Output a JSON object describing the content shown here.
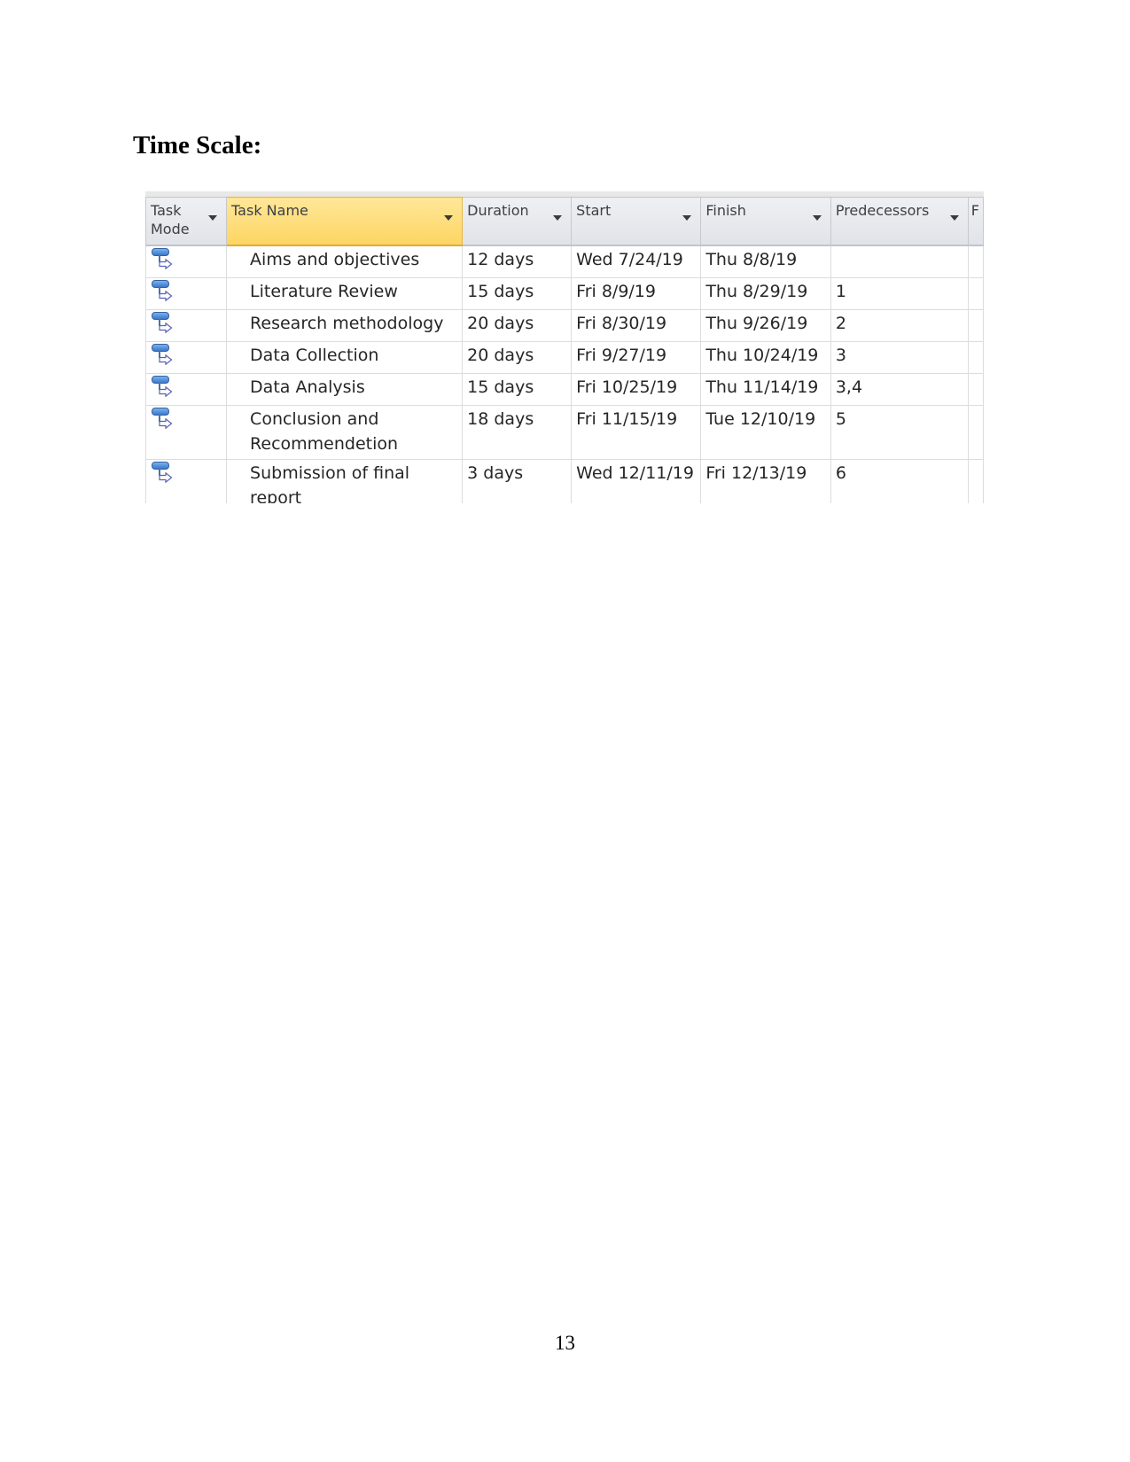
{
  "document": {
    "heading": "Time Scale:",
    "page_number": "13"
  },
  "table": {
    "columns": [
      {
        "key": "task_mode",
        "label": "Task Mode",
        "has_dropdown": true
      },
      {
        "key": "task_name",
        "label": "Task Name",
        "has_dropdown": true,
        "selected": true
      },
      {
        "key": "duration",
        "label": "Duration",
        "has_dropdown": true
      },
      {
        "key": "start",
        "label": "Start",
        "has_dropdown": true
      },
      {
        "key": "finish",
        "label": "Finish",
        "has_dropdown": true
      },
      {
        "key": "predecessors",
        "label": "Predecessors",
        "has_dropdown": true
      },
      {
        "key": "truncated",
        "label": "F",
        "has_dropdown": false
      }
    ],
    "task_mode_icon": "auto-scheduled-task-icon",
    "accent_color": "#fdd560",
    "rows": [
      {
        "task_name": "Aims and objectives",
        "duration": "12 days",
        "start": "Wed 7/24/19",
        "finish": "Thu 8/8/19",
        "predecessors": ""
      },
      {
        "task_name": "Literature Review",
        "duration": "15 days",
        "start": "Fri 8/9/19",
        "finish": "Thu 8/29/19",
        "predecessors": "1"
      },
      {
        "task_name": "Research methodology",
        "duration": "20 days",
        "start": "Fri 8/30/19",
        "finish": "Thu 9/26/19",
        "predecessors": "2"
      },
      {
        "task_name": "Data Collection",
        "duration": "20 days",
        "start": "Fri 9/27/19",
        "finish": "Thu 10/24/19",
        "predecessors": "3"
      },
      {
        "task_name": "Data Analysis",
        "duration": "15 days",
        "start": "Fri 10/25/19",
        "finish": "Thu 11/14/19",
        "predecessors": "3,4"
      },
      {
        "task_name": "Conclusion and Recommendetion",
        "duration": "18 days",
        "start": "Fri 11/15/19",
        "finish": "Tue 12/10/19",
        "predecessors": "5"
      },
      {
        "task_name": "Submission of final report",
        "duration": "3 days",
        "start": "Wed 12/11/19",
        "finish": "Fri 12/13/19",
        "predecessors": "6"
      }
    ]
  }
}
